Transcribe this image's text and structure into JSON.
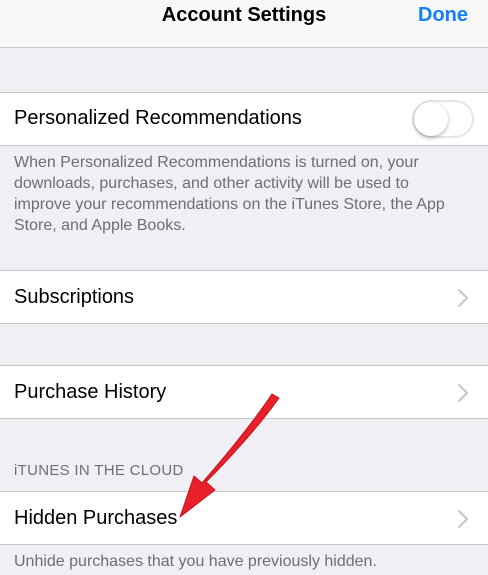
{
  "nav": {
    "title": "Account Settings",
    "done_label": "Done"
  },
  "recommendations": {
    "label": "Personalized Recommendations",
    "toggle_on": false,
    "description": "When Personalized Recommendations is turned on, your downloads, purchases, and other activity will be used to improve your recommendations on the iTunes Store, the App Store, and Apple Books."
  },
  "subscriptions": {
    "label": "Subscriptions"
  },
  "purchase_history": {
    "label": "Purchase History"
  },
  "itunes_cloud": {
    "header": "iTUNES IN THE CLOUD",
    "hidden_purchases_label": "Hidden Purchases",
    "hidden_purchases_footer": "Unhide purchases that you have previously hidden."
  },
  "colors": {
    "accent": "#147efb",
    "background": "#efeff4",
    "annotation_arrow": "#e8202a"
  }
}
